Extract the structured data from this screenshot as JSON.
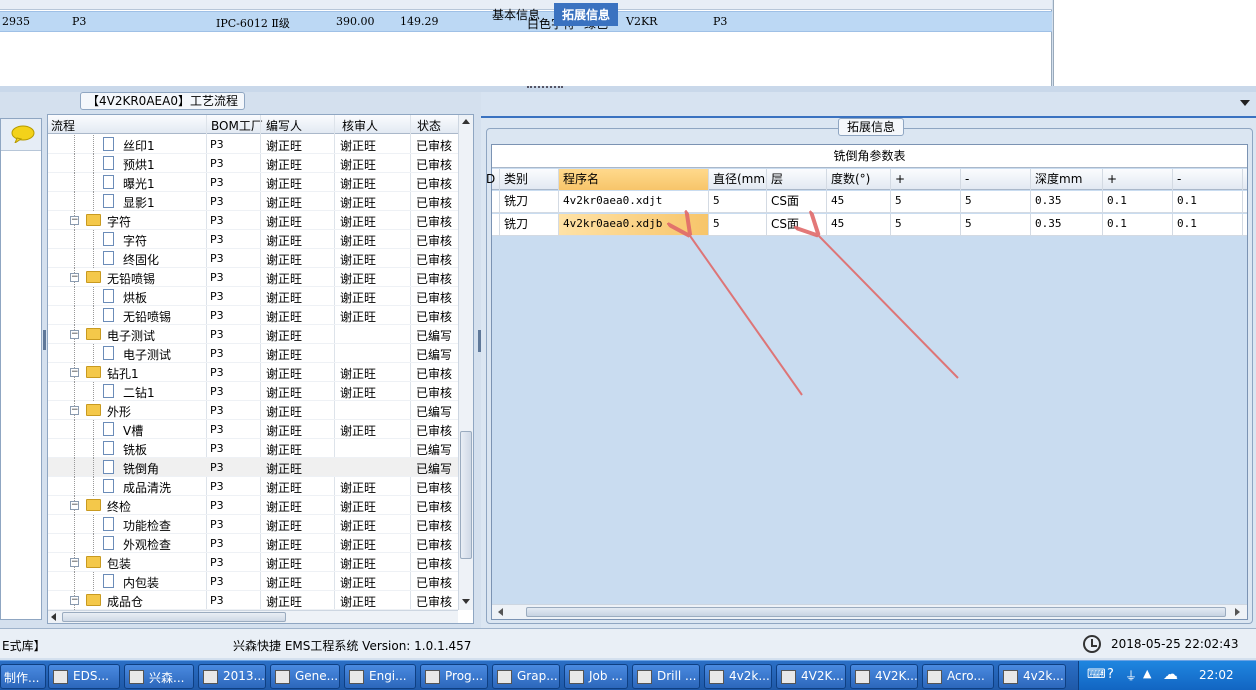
{
  "top_grid": {
    "row": [
      "2935",
      "P3",
      "IPC-6012 Ⅱ级",
      "390.00",
      "149.29",
      "白色字符",
      "绿色",
      "V2KR",
      "P3"
    ]
  },
  "tree_panel": {
    "group_title": "【4V2KR0AEA0】工艺流程",
    "columns": [
      "流程",
      "BOM工厂",
      "编写人",
      "核审人",
      "状态"
    ],
    "rows": [
      {
        "name": "丝印1",
        "kind": "doc",
        "bom": "P3",
        "writer": "谢正旺",
        "reviewer": "谢正旺",
        "status": "已审核"
      },
      {
        "name": "预烘1",
        "kind": "doc",
        "bom": "P3",
        "writer": "谢正旺",
        "reviewer": "谢正旺",
        "status": "已审核"
      },
      {
        "name": "曝光1",
        "kind": "doc",
        "bom": "P3",
        "writer": "谢正旺",
        "reviewer": "谢正旺",
        "status": "已审核"
      },
      {
        "name": "显影1",
        "kind": "doc",
        "bom": "P3",
        "writer": "谢正旺",
        "reviewer": "谢正旺",
        "status": "已审核"
      },
      {
        "name": "字符",
        "kind": "folder",
        "bom": "P3",
        "writer": "谢正旺",
        "reviewer": "谢正旺",
        "status": "已审核"
      },
      {
        "name": "字符",
        "kind": "doc",
        "bom": "P3",
        "writer": "谢正旺",
        "reviewer": "谢正旺",
        "status": "已审核"
      },
      {
        "name": "终固化",
        "kind": "doc",
        "bom": "P3",
        "writer": "谢正旺",
        "reviewer": "谢正旺",
        "status": "已审核"
      },
      {
        "name": "无铅喷锡",
        "kind": "folder",
        "bom": "P3",
        "writer": "谢正旺",
        "reviewer": "谢正旺",
        "status": "已审核"
      },
      {
        "name": "烘板",
        "kind": "doc",
        "bom": "P3",
        "writer": "谢正旺",
        "reviewer": "谢正旺",
        "status": "已审核"
      },
      {
        "name": "无铅喷锡",
        "kind": "doc",
        "bom": "P3",
        "writer": "谢正旺",
        "reviewer": "谢正旺",
        "status": "已审核"
      },
      {
        "name": "电子测试",
        "kind": "folder",
        "bom": "P3",
        "writer": "谢正旺",
        "reviewer": "",
        "status": "已编写"
      },
      {
        "name": "电子测试",
        "kind": "doc",
        "bom": "P3",
        "writer": "谢正旺",
        "reviewer": "",
        "status": "已编写"
      },
      {
        "name": "钻孔1",
        "kind": "folder",
        "bom": "P3",
        "writer": "谢正旺",
        "reviewer": "谢正旺",
        "status": "已审核"
      },
      {
        "name": "二钻1",
        "kind": "doc",
        "bom": "P3",
        "writer": "谢正旺",
        "reviewer": "谢正旺",
        "status": "已审核"
      },
      {
        "name": "外形",
        "kind": "folder",
        "bom": "P3",
        "writer": "谢正旺",
        "reviewer": "",
        "status": "已编写"
      },
      {
        "name": "V槽",
        "kind": "doc",
        "bom": "P3",
        "writer": "谢正旺",
        "reviewer": "谢正旺",
        "status": "已审核"
      },
      {
        "name": "铣板",
        "kind": "doc",
        "bom": "P3",
        "writer": "谢正旺",
        "reviewer": "",
        "status": "已编写"
      },
      {
        "name": "铣倒角",
        "kind": "doc",
        "bom": "P3",
        "writer": "谢正旺",
        "reviewer": "",
        "status": "已编写",
        "selected": true
      },
      {
        "name": "成品清洗",
        "kind": "doc",
        "bom": "P3",
        "writer": "谢正旺",
        "reviewer": "谢正旺",
        "status": "已审核"
      },
      {
        "name": "终检",
        "kind": "folder",
        "bom": "P3",
        "writer": "谢正旺",
        "reviewer": "谢正旺",
        "status": "已审核"
      },
      {
        "name": "功能检查",
        "kind": "doc",
        "bom": "P3",
        "writer": "谢正旺",
        "reviewer": "谢正旺",
        "status": "已审核"
      },
      {
        "name": "外观检查",
        "kind": "doc",
        "bom": "P3",
        "writer": "谢正旺",
        "reviewer": "谢正旺",
        "status": "已审核"
      },
      {
        "name": "包装",
        "kind": "folder",
        "bom": "P3",
        "writer": "谢正旺",
        "reviewer": "谢正旺",
        "status": "已审核"
      },
      {
        "name": "内包装",
        "kind": "doc",
        "bom": "P3",
        "writer": "谢正旺",
        "reviewer": "谢正旺",
        "status": "已审核"
      },
      {
        "name": "成品仓",
        "kind": "folder",
        "bom": "P3",
        "writer": "谢正旺",
        "reviewer": "谢正旺",
        "status": "已审核"
      }
    ]
  },
  "right_panel": {
    "tabs": [
      "基本信息",
      "拓展信息"
    ],
    "active_tab": "拓展信息",
    "group_title": "拓展信息",
    "table_title": "铣倒角参数表",
    "columns": [
      "D",
      "类别",
      "程序名",
      "直径(mm)",
      "层",
      "度数(°)",
      "+",
      "-",
      "深度mm",
      "+",
      "-"
    ],
    "rows": [
      [
        "",
        "铣刀",
        "4v2kr0aea0.xdjt",
        "5",
        "CS面",
        "45",
        "5",
        "5",
        "0.35",
        "0.1",
        "0.1"
      ],
      [
        "",
        "铣刀",
        "4v2kr0aea0.xdjb",
        "5",
        "CS面",
        "45",
        "5",
        "5",
        "0.35",
        "0.1",
        "0.1"
      ]
    ]
  },
  "status_bar": {
    "left": "E式库】",
    "center": "兴森快捷 EMS工程系统 Version: 1.0.1.457",
    "datetime": "2018-05-25 22:02:43"
  },
  "taskbar": {
    "tasks": [
      "制作...",
      "EDS...",
      "兴森...",
      "2013...",
      "Gene...",
      "Engi...",
      "Prog...",
      "Grap...",
      "Job ...",
      "Drill ...",
      "4v2k...",
      "4V2K...",
      "4V2K...",
      "Acro...",
      "4v2k..."
    ],
    "time": "22:02"
  },
  "colors": {
    "tab_active": "#3a72c0",
    "row_selected": "#bcd8f4",
    "highlight_cell": "#f7c56a",
    "arrow": "#e06a6a"
  }
}
